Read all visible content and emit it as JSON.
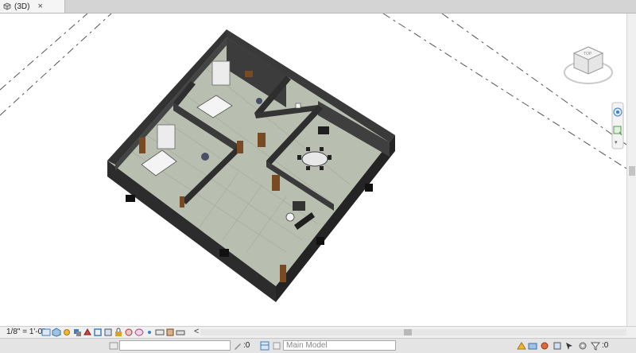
{
  "tab": {
    "label": "(3D)",
    "close": "×"
  },
  "viewbar": {
    "scale": "1/8\" = 1'-0\"",
    "scroll_left": "<"
  },
  "statusbar": {
    "workset_count": ":0",
    "model_select": "Main Model",
    "filter_count": ":0"
  },
  "colors": {
    "wall": "#3a3a3a",
    "wall_dark": "#242424",
    "floor": "#b9bfb0",
    "door": "#7a4a22",
    "accent_blue": "#3d7fc2"
  },
  "icons": [
    "view-cube-icon",
    "navigation-wheel-icon",
    "zoom-icon",
    "visual-style-icon",
    "shadows-icon",
    "crop-icon",
    "workset-icon",
    "design-option-icon",
    "filter-icon"
  ]
}
